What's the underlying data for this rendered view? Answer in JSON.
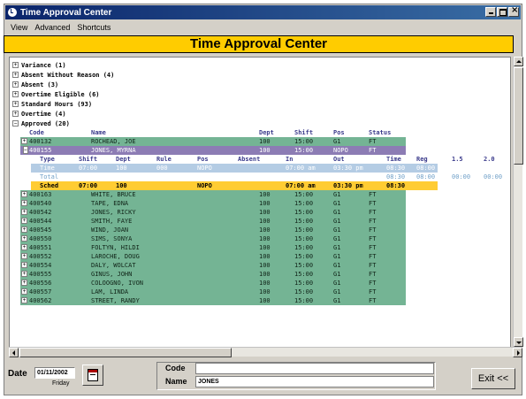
{
  "window": {
    "title": "Time Approval Center"
  },
  "menu": [
    "View",
    "Advanced",
    "Shortcuts"
  ],
  "banner": {
    "title": "Time Approval Center",
    "color": "#ffcc00"
  },
  "categories": [
    {
      "label": "Variance (1)",
      "toggle": "+"
    },
    {
      "label": "Absent Without Reason (4)",
      "toggle": "+"
    },
    {
      "label": "Absent (3)",
      "toggle": "+"
    },
    {
      "label": "Overtime Eligible (6)",
      "toggle": "+"
    },
    {
      "label": "Standard Hours (93)",
      "toggle": "+"
    },
    {
      "label": "Overtime (4)",
      "toggle": "+"
    },
    {
      "label": "Approved (20)",
      "toggle": "−"
    }
  ],
  "grid": {
    "columns": [
      "Code",
      "Name",
      "Dept",
      "Shift",
      "Pos",
      "Status"
    ],
    "selected": {
      "code": "400155",
      "name": "JONES, MYRNA",
      "dept": "100",
      "shift": "15:00",
      "pos": "NOPO",
      "status": "FT"
    },
    "first_row": {
      "code": "400132",
      "name": "ROCHEAD, JOE",
      "dept": "100",
      "shift": "15:00",
      "pos": "G1",
      "status": "FT"
    },
    "detail_columns": [
      "Type",
      "Shift",
      "Dept",
      "Rule",
      "Pos",
      "Absent",
      "In",
      "Out",
      "Time",
      "Reg",
      "1.5",
      "2.0"
    ],
    "time_row": {
      "type": "Time",
      "shift": "07:00",
      "dept": "100",
      "rule": "000",
      "pos": "NOPO",
      "in": "07:00 am",
      "out": "03:30 pm",
      "time": "08:30",
      "reg": "08:00"
    },
    "total_row": {
      "type": "Total",
      "time": "08:30",
      "reg": "08:00",
      "ot15": "00:00",
      "ot20": "00:00"
    },
    "sched_row": {
      "type": "Sched",
      "shift": "07:00",
      "dept": "100",
      "pos": "NOPO",
      "in": "07:00 am",
      "out": "03:30 pm",
      "time": "08:30"
    },
    "employees": [
      {
        "code": "400163",
        "name": "WHITE, BRUCE",
        "dept": "100",
        "shift": "15:00",
        "pos": "G1",
        "status": "FT"
      },
      {
        "code": "400540",
        "name": "TAPE, EDNA",
        "dept": "100",
        "shift": "15:00",
        "pos": "G1",
        "status": "FT"
      },
      {
        "code": "400542",
        "name": "JONES, RICKY",
        "dept": "100",
        "shift": "15:00",
        "pos": "G1",
        "status": "FT"
      },
      {
        "code": "400544",
        "name": "SMITH, FAYE",
        "dept": "100",
        "shift": "15:00",
        "pos": "G1",
        "status": "FT"
      },
      {
        "code": "400545",
        "name": "WIND, JOAN",
        "dept": "100",
        "shift": "15:00",
        "pos": "G1",
        "status": "FT"
      },
      {
        "code": "400550",
        "name": "SIMS, SONYA",
        "dept": "100",
        "shift": "15:00",
        "pos": "G1",
        "status": "FT"
      },
      {
        "code": "400551",
        "name": "FOLTYN, HILDI",
        "dept": "100",
        "shift": "15:00",
        "pos": "G1",
        "status": "FT"
      },
      {
        "code": "400552",
        "name": "LAROCHE, DOUG",
        "dept": "100",
        "shift": "15:00",
        "pos": "G1",
        "status": "FT"
      },
      {
        "code": "400554",
        "name": "DALY, WOLCAT",
        "dept": "100",
        "shift": "15:00",
        "pos": "G1",
        "status": "FT"
      },
      {
        "code": "400555",
        "name": "GINUS, JOHN",
        "dept": "100",
        "shift": "15:00",
        "pos": "G1",
        "status": "FT"
      },
      {
        "code": "400556",
        "name": "COLOOGNO, IVON",
        "dept": "100",
        "shift": "15:00",
        "pos": "G1",
        "status": "FT"
      },
      {
        "code": "400557",
        "name": "LAM, LINDA",
        "dept": "100",
        "shift": "15:00",
        "pos": "G1",
        "status": "FT"
      },
      {
        "code": "400562",
        "name": "STREET, RANDY",
        "dept": "100",
        "shift": "15:00",
        "pos": "G1",
        "status": "FT"
      }
    ]
  },
  "bottom": {
    "date_label": "Date",
    "date_value": "01/11/2002",
    "day": "Friday",
    "code_label": "Code",
    "code_value": "",
    "name_label": "Name",
    "name_value": "JONES",
    "exit_label": "Exit <<"
  }
}
